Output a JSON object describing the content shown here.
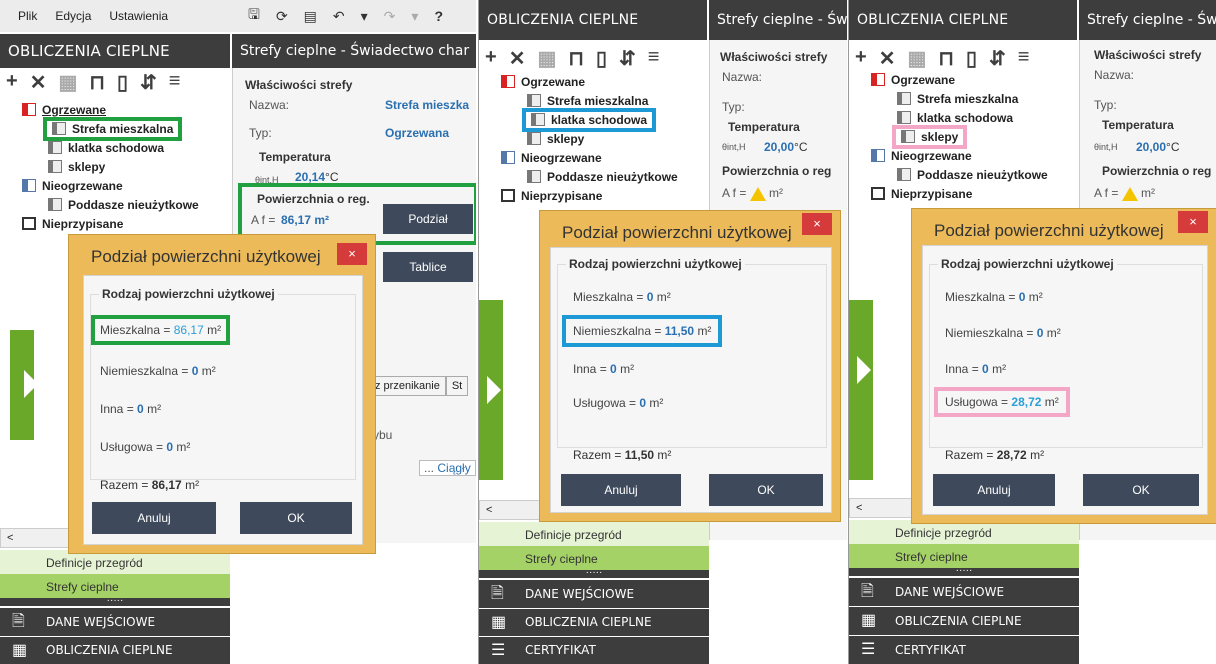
{
  "menu": {
    "file": "Plik",
    "edit": "Edycja",
    "settings": "Ustawienia"
  },
  "toolbar": {
    "icons": [
      "save-icon",
      "refresh-icon",
      "copy-icon",
      "undo-icon",
      "undo-dropdown-icon",
      "redo-icon",
      "redo-dropdown-icon",
      "help-icon"
    ],
    "help": "?"
  },
  "left_title": "OBLICZENIA CIEPLNE",
  "right_title": "Strefy cieplne - Świadectwo char",
  "right_title_short": "Strefy cieplne - Świ",
  "right_title_short3": "Strefy cieplne - Św",
  "tree": {
    "heated": "Ogrzewane",
    "zone1": "Strefa mieszkalna",
    "zone2": "klatka schodowa",
    "zone3": "sklepy",
    "unheated": "Nieogrzewane",
    "zone4": "Poddasze nieużytkowe",
    "unassigned": "Nieprzypisane"
  },
  "props": {
    "header": "Właściwości strefy",
    "name_label": "Nazwa:",
    "name_value": "Strefa mieszka",
    "type_label": "Typ:",
    "type_value": "Ogrzewana",
    "temp_header": "Temperatura",
    "temp_symbol": "θint,H",
    "temp_value_1": "20,14",
    "temp_value_2": "20,00",
    "temp_unit": "°C",
    "area_header_1": "Powierzchnia o reg.",
    "area_header_2": "Powierzchnia o reg",
    "area_symbol": "A f =",
    "area_value_1": "86,17 m²",
    "area_unit": "m²",
    "podzial_btn": "Podział",
    "tablice_btn": "Tablice",
    "tabs": [
      "z przenikanie",
      "St"
    ],
    "field_suffix": "ybu",
    "dots": "...",
    "ciagly": "Ciągły"
  },
  "nav": {
    "defs": "Definicje przegród",
    "zones": "Strefy cieplne",
    "dots": "·····",
    "input": "DANE WEJŚCIOWE",
    "calc": "OBLICZENIA CIEPLNE",
    "cert": "CERTYFIKAT",
    "scroll_left": "<"
  },
  "dialog": {
    "title": "Podział powierzchni użytkowej",
    "close": "×",
    "group": "Rodzaj powierzchni użytkowej",
    "mieszkalna": "Mieszkalna =",
    "niemieszkalna": "Niemieszkalna =",
    "inna": "Inna =",
    "uslugowa": "Usługowa =",
    "razem": "Razem =",
    "cancel": "Anuluj",
    "ok": "OK",
    "unit": "m²"
  },
  "d1": {
    "mieszkalna": "86,17",
    "niemieszkalna": "0",
    "inna": "0",
    "uslugowa": "0",
    "razem": "86,17"
  },
  "d2": {
    "mieszkalna": "0",
    "niemieszkalna": "11,50",
    "inna": "0",
    "uslugowa": "0",
    "razem": "11,50"
  },
  "d3": {
    "mieszkalna": "0",
    "niemieszkalna": "0",
    "inna": "0",
    "uslugowa": "28,72",
    "razem": "28,72"
  },
  "colors": {
    "highlight_green": "#21a03f",
    "highlight_blue": "#1d9ad6",
    "highlight_pink": "#f4a6c6",
    "dialog_bg": "#ecba58",
    "accent_green": "#6aa82a"
  }
}
